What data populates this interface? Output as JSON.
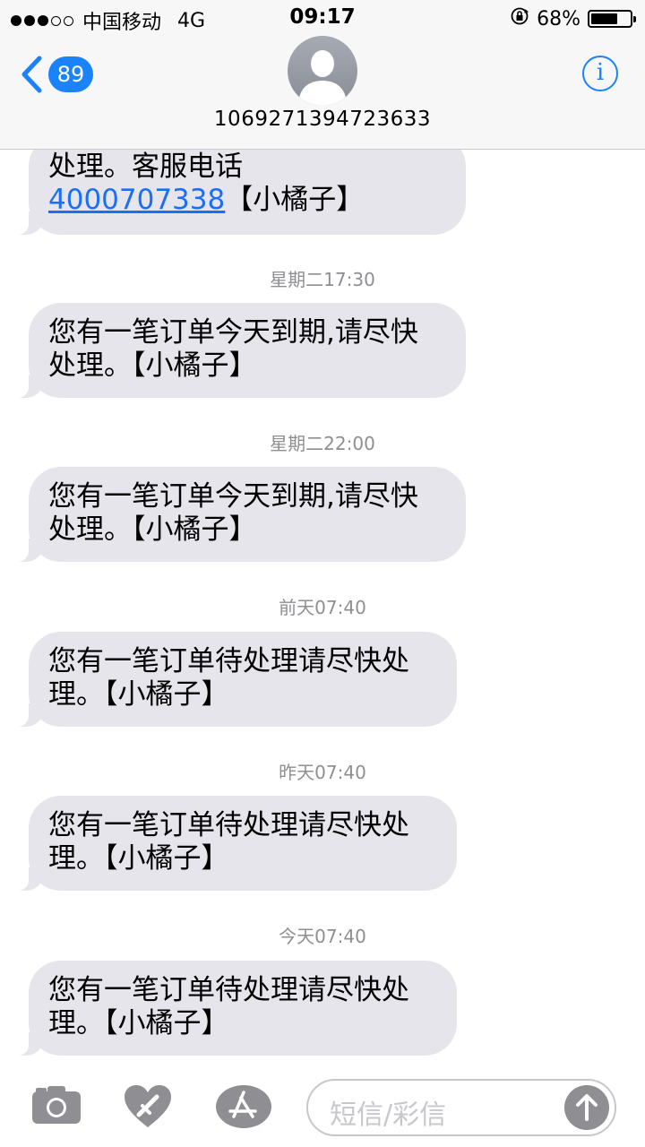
{
  "status_bar": {
    "carrier": "中国移动",
    "network": "4G",
    "time": "09:17",
    "battery_percent": "68%",
    "battery_level": 0.68
  },
  "nav": {
    "back_badge": "89",
    "contact_number": "1069271394723633",
    "info_icon": "i"
  },
  "messages": [
    {
      "lines": [
        "处理。客服电话"
      ],
      "phone_link": "4000707338",
      "suffix": "【小橘子】"
    },
    {
      "timestamp": "星期二17:30",
      "lines": [
        "您有一笔订单今天到期,请尽快",
        "处理。【小橘子】"
      ]
    },
    {
      "timestamp": "星期二22:00",
      "lines": [
        "您有一笔订单今天到期,请尽快",
        "处理。【小橘子】"
      ]
    },
    {
      "timestamp": "前天07:40",
      "lines": [
        "您有一笔订单待处理请尽快处",
        "理。【小橘子】"
      ]
    },
    {
      "timestamp": "昨天07:40",
      "lines": [
        "您有一笔订单待处理请尽快处",
        "理。【小橘子】"
      ]
    },
    {
      "timestamp": "今天07:40",
      "lines": [
        "您有一笔订单待处理请尽快处",
        "理。【小橘子】"
      ]
    }
  ],
  "input_bar": {
    "placeholder": "短信/彩信",
    "icons": [
      "camera-icon",
      "digital-touch-icon",
      "app-store-icon",
      "send-arrow-icon"
    ]
  },
  "colors": {
    "accent": "#1a82fb",
    "bubble": "#e6e5eb",
    "timestamp": "#8e8e93"
  }
}
